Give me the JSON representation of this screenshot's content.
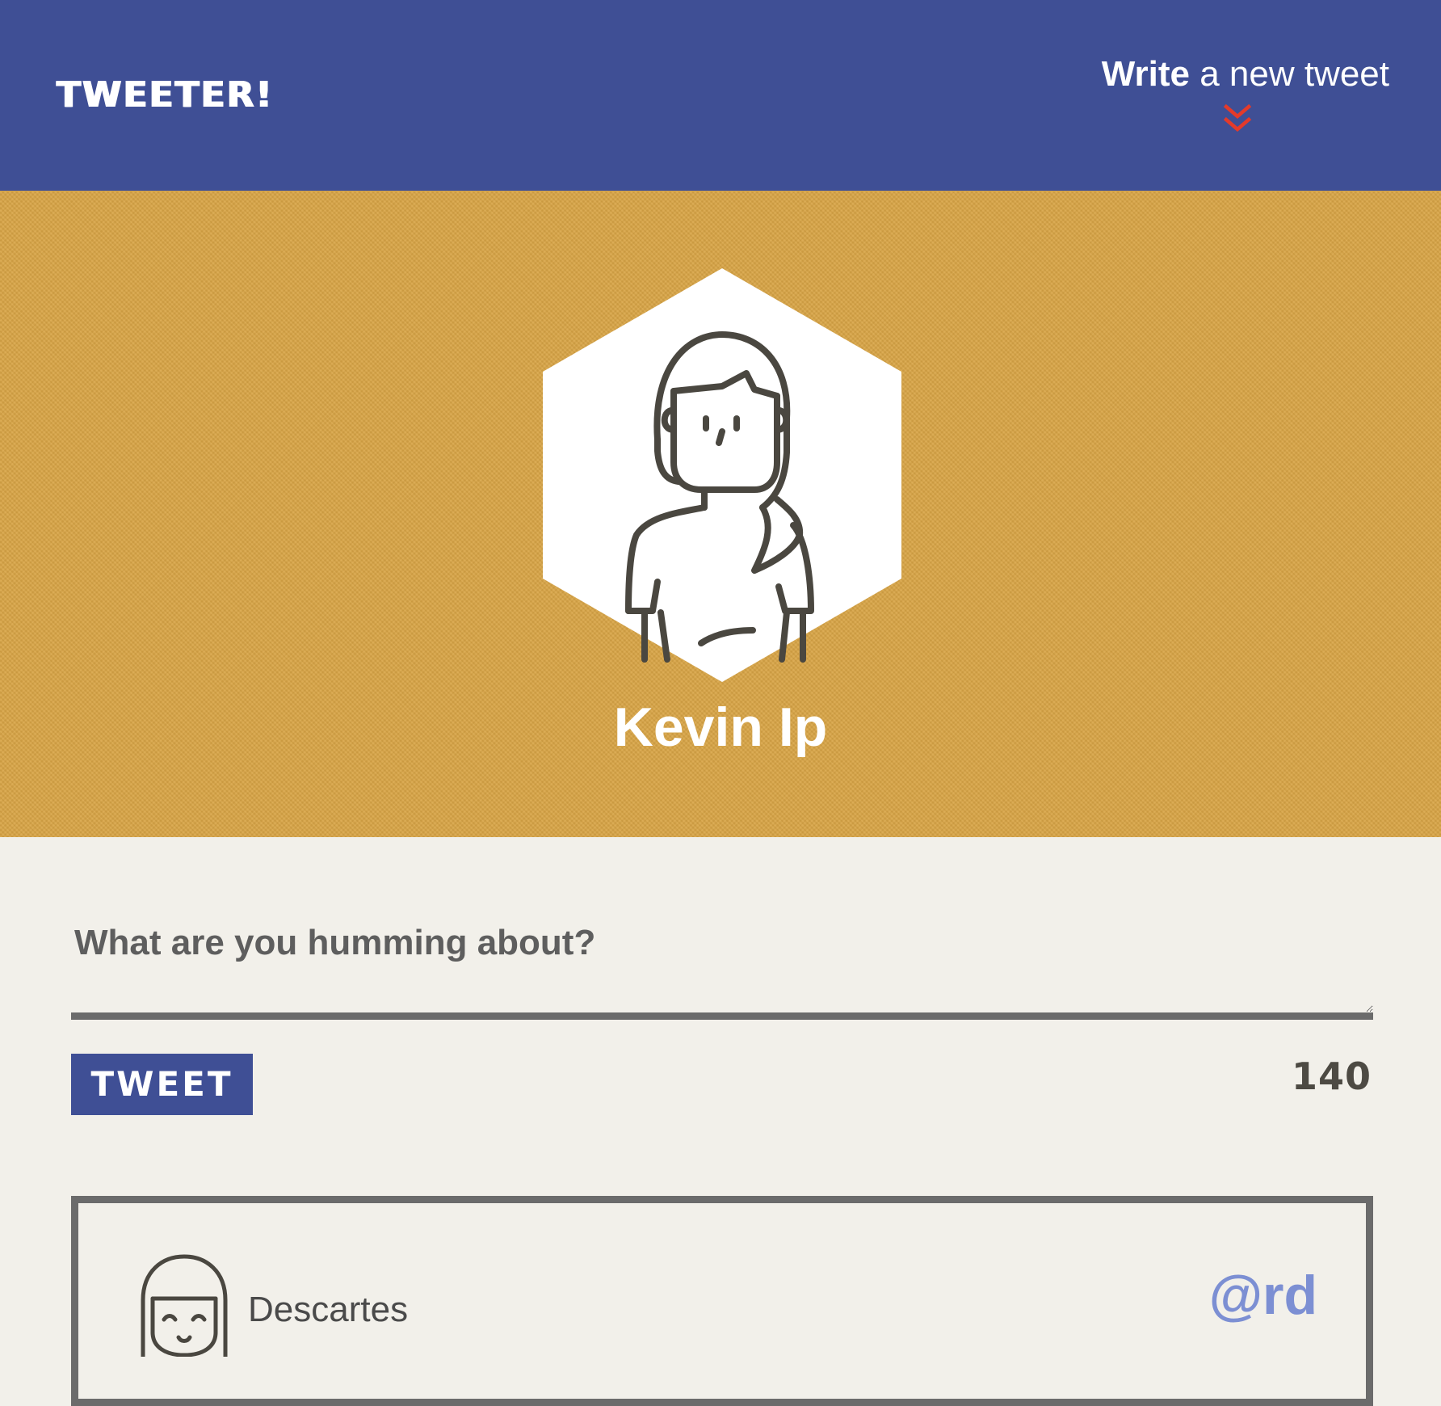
{
  "navbar": {
    "brand": "TWEETER!",
    "compose_bold": "Write",
    "compose_rest": " a new tweet",
    "compose_icon": "double-chevron-down-icon",
    "background_color": "#3f4f95",
    "chevron_color": "#e43a2a"
  },
  "profile": {
    "name": "Kevin Ip",
    "avatar_icon": "woman-avatar-icon",
    "background_color": "#d8a445"
  },
  "composer": {
    "placeholder": "What are you humming about?",
    "value": "",
    "button_label": "TWEET",
    "char_count": "140"
  },
  "tweets": [
    {
      "name": "Descartes",
      "handle": "@rd",
      "avatar_icon": "person-avatar-icon",
      "handle_color": "#7c8fd3"
    }
  ]
}
